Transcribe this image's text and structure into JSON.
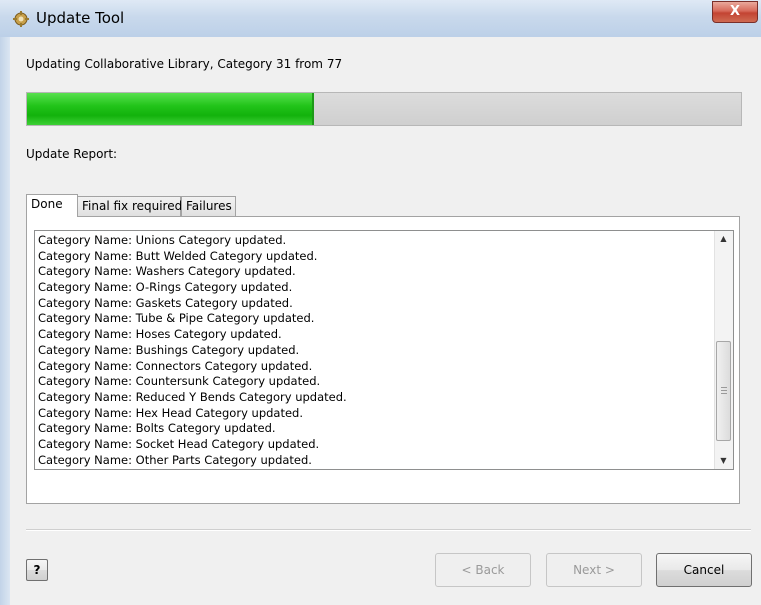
{
  "window": {
    "title": "Update Tool",
    "close_label": "X"
  },
  "status_text": "Updating Collaborative Library, Category 31 from 77",
  "progress": {
    "current": 31,
    "total": 77,
    "fraction": 0.4026
  },
  "report_label": "Update Report:",
  "tabs": [
    {
      "label": "Done",
      "active": true
    },
    {
      "label": "Final fix required",
      "active": false
    },
    {
      "label": "Failures",
      "active": false
    }
  ],
  "report_lines": [
    "Category Name: Unions Category updated.",
    "Category Name: Butt Welded Category updated.",
    "Category Name: Washers Category updated.",
    "Category Name: O-Rings Category updated.",
    "Category Name: Gaskets Category updated.",
    "Category Name: Tube & Pipe Category updated.",
    "Category Name: Hoses Category updated.",
    "Category Name: Bushings Category updated.",
    "Category Name: Connectors Category updated.",
    "Category Name: Countersunk Category updated.",
    "Category Name: Reduced Y Bends Category updated.",
    "Category Name: Hex Head Category updated.",
    "Category Name: Bolts Category updated.",
    "Category Name: Socket Head Category updated.",
    "Category Name: Other Parts Category updated."
  ],
  "buttons": {
    "help": "?",
    "back": "< Back",
    "next": "Next >",
    "cancel": "Cancel"
  },
  "colors": {
    "progress_fill": "#22c41a",
    "progress_track": "#d4d4d4",
    "close_button": "#c94a3a"
  }
}
